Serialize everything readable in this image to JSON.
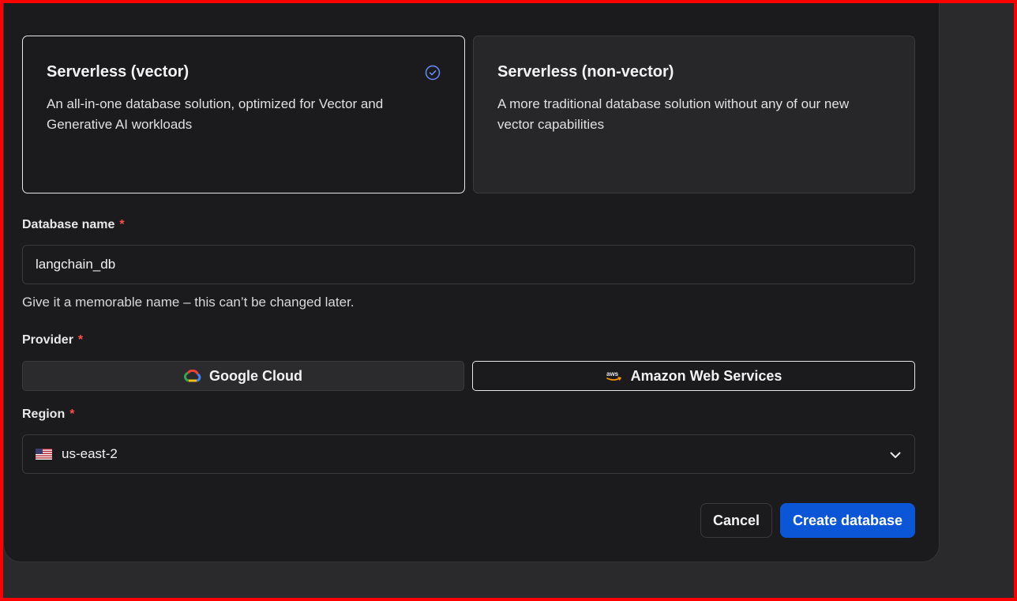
{
  "cards": [
    {
      "title": "Serverless (vector)",
      "description": "An all-in-one database solution, optimized for Vector and Generative AI workloads",
      "selected": true
    },
    {
      "title": "Serverless (non-vector)",
      "description": "A more traditional database solution without any of our new vector capabilities",
      "selected": false
    }
  ],
  "database_name": {
    "label": "Database name",
    "required_mark": "*",
    "value": "langchain_db",
    "hint": "Give it a memorable name – this can’t be changed later."
  },
  "provider": {
    "label": "Provider",
    "required_mark": "*",
    "options": [
      {
        "label": "Google Cloud",
        "icon": "google-cloud-icon",
        "selected": false
      },
      {
        "label": "Amazon Web Services",
        "icon": "aws-icon",
        "selected": true
      }
    ]
  },
  "region": {
    "label": "Region",
    "required_mark": "*",
    "value": "us-east-2",
    "flag": "us-flag-icon"
  },
  "actions": {
    "cancel_label": "Cancel",
    "create_label": "Create database"
  },
  "colors": {
    "accent": "#0b56d6",
    "required": "#ff4d4d",
    "selected_check": "#6b8cff"
  }
}
